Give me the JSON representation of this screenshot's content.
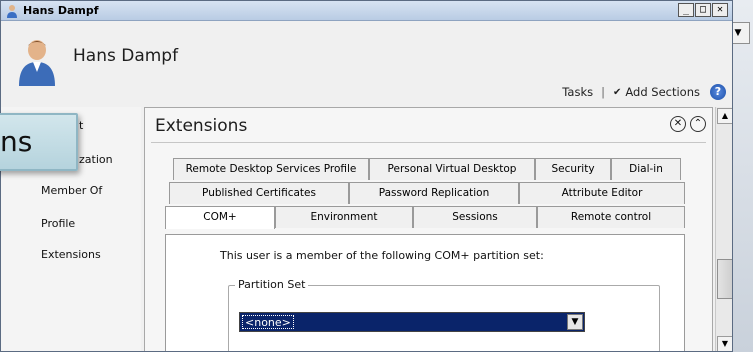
{
  "window": {
    "title": "Hans Dampf",
    "buttons": {
      "minimize": "_",
      "maximize": "□",
      "close": "✕"
    }
  },
  "header": {
    "user_name": "Hans Dampf",
    "tasks_label": "Tasks",
    "separator": "|",
    "add_sections_label": "Add Sections",
    "help_glyph": "?"
  },
  "nav": {
    "items": [
      {
        "label": "t"
      },
      {
        "label": "zation"
      },
      {
        "label": "Member Of"
      },
      {
        "label": "Profile"
      },
      {
        "label": "Extensions"
      }
    ]
  },
  "callout": {
    "text": "ns"
  },
  "panel": {
    "title": "Extensions",
    "tab_rows": [
      [
        {
          "label": "Remote Desktop Services Profile"
        },
        {
          "label": "Personal Virtual Desktop"
        },
        {
          "label": "Security"
        },
        {
          "label": "Dial-in"
        }
      ],
      [
        {
          "label": "Published Certificates"
        },
        {
          "label": "Password Replication"
        },
        {
          "label": "Attribute Editor"
        }
      ],
      [
        {
          "label": "COM+",
          "active": true
        },
        {
          "label": "Environment"
        },
        {
          "label": "Sessions"
        },
        {
          "label": "Remote control"
        }
      ]
    ],
    "description": "This user is a member of the following COM+ partition set:",
    "group_label": "Partition Set",
    "partition_value": "<none>"
  },
  "colors": {
    "selection": "#0a246a",
    "help_icon": "#1b4fa8",
    "callout_bg": "#c4dde5"
  }
}
